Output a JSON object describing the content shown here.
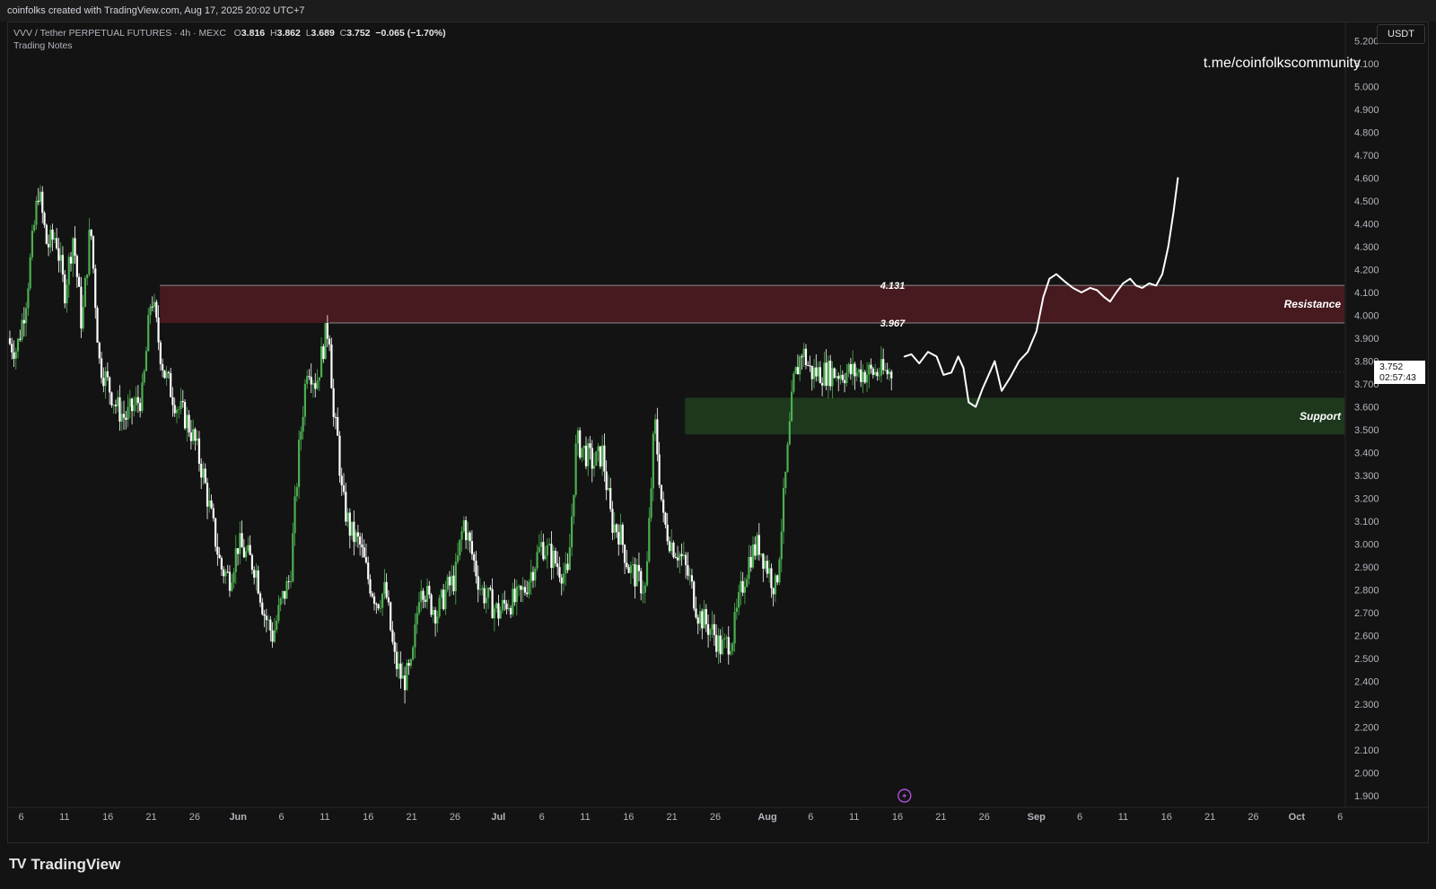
{
  "header": {
    "attribution": "coinfolks created with TradingView.com, Aug 17, 2025 20:02 UTC+7"
  },
  "legend": {
    "symbol": "VVV / Tether PERPETUAL FUTURES · 4h · MEXC",
    "o_label": "O",
    "o_value": "3.816",
    "h_label": "H",
    "h_value": "3.862",
    "l_label": "L",
    "l_value": "3.689",
    "c_label": "C",
    "c_value": "3.752",
    "change": "−0.065 (−1.70%)",
    "indicator": "Trading Notes"
  },
  "watermark": "t.me/coinfolkscommunity",
  "currency": "USDT",
  "last_price": {
    "value": "3.752",
    "countdown": "02:57:43"
  },
  "brand": {
    "logo_mark": "TV",
    "name": "TradingView"
  },
  "colors": {
    "background": "#131313",
    "up": "#4caf50",
    "down": "#ffffff",
    "resistance_zone": "#4a1a20",
    "support_zone": "#1f3a1f"
  },
  "chart_data": {
    "type": "line",
    "title": "VVV / Tether PERPETUAL FUTURES · 4h · MEXC",
    "ylabel": "USDT",
    "y_axis_side": "right",
    "ylim": [
      1.85,
      5.28
    ],
    "y_ticks": [
      "5.200",
      "5.100",
      "5.000",
      "4.900",
      "4.800",
      "4.700",
      "4.600",
      "4.500",
      "4.400",
      "4.300",
      "4.200",
      "4.100",
      "4.000",
      "3.900",
      "3.800",
      "3.700",
      "3.600",
      "3.500",
      "3.400",
      "3.300",
      "3.200",
      "3.100",
      "3.000",
      "2.900",
      "2.800",
      "2.700",
      "2.600",
      "2.500",
      "2.400",
      "2.300",
      "2.200",
      "2.100",
      "2.000",
      "1.900"
    ],
    "x_ticks": [
      "6",
      "11",
      "16",
      "21",
      "26",
      "Jun",
      "6",
      "11",
      "16",
      "21",
      "26",
      "Jul",
      "6",
      "11",
      "16",
      "21",
      "26",
      "Aug",
      "6",
      "11",
      "16",
      "21",
      "26",
      "Sep",
      "6",
      "11",
      "16",
      "21",
      "26",
      "Oct",
      "6"
    ],
    "x_tick_days": [
      -25,
      -20,
      -15,
      -10,
      -5,
      0,
      5,
      10,
      15,
      20,
      25,
      30,
      35,
      40,
      45,
      50,
      55,
      61,
      66,
      71,
      76,
      81,
      86,
      92,
      97,
      102,
      107,
      112,
      117,
      122,
      127
    ],
    "xlim_days": [
      -26.5,
      127.5
    ],
    "price_series": {
      "name": "VVV/USDT 4h",
      "days": [
        -27,
        -25.5,
        -24.5,
        -23,
        -22,
        -21,
        -20,
        -19,
        -18,
        -17,
        -16,
        -15,
        -14,
        -13,
        -12,
        -11,
        -10,
        -9,
        -8.5,
        -8,
        -7,
        -6,
        -5,
        -4,
        -3,
        -2,
        -1,
        0,
        1,
        2,
        3,
        4,
        5,
        6,
        7,
        8,
        9,
        10,
        10.5,
        11,
        11.5,
        12,
        13,
        14,
        15,
        16,
        17,
        18,
        19,
        20,
        21,
        22,
        23,
        24,
        25,
        26,
        27,
        28,
        29,
        30,
        31,
        32,
        33,
        34,
        35,
        36,
        37,
        38,
        39,
        40,
        41,
        42,
        43,
        44,
        45,
        46,
        47,
        48,
        49,
        50,
        51,
        52,
        53,
        54,
        55,
        55.5,
        56,
        57,
        58,
        59,
        60,
        61,
        62,
        63,
        64,
        65,
        66,
        67,
        68,
        69,
        70,
        71,
        72,
        73,
        74,
        75,
        75.5,
        76
      ],
      "close": [
        3.9,
        3.85,
        4.05,
        4.55,
        4.3,
        4.35,
        4.1,
        4.35,
        3.95,
        4.4,
        3.8,
        3.7,
        3.6,
        3.55,
        3.6,
        3.65,
        4.1,
        3.85,
        3.75,
        3.7,
        3.6,
        3.55,
        3.45,
        3.3,
        3.1,
        2.9,
        2.85,
        3.0,
        2.95,
        2.9,
        2.7,
        2.6,
        2.75,
        2.85,
        3.4,
        3.8,
        3.7,
        3.9,
        3.95,
        3.55,
        3.45,
        3.2,
        3.05,
        3.0,
        2.85,
        2.75,
        2.8,
        2.5,
        2.4,
        2.45,
        2.85,
        2.75,
        2.7,
        2.8,
        2.85,
        3.1,
        2.95,
        2.8,
        2.75,
        2.7,
        2.75,
        2.75,
        2.8,
        2.9,
        3.0,
        2.95,
        2.9,
        2.85,
        3.45,
        3.4,
        3.35,
        3.4,
        3.1,
        3.05,
        2.9,
        2.85,
        2.8,
        3.55,
        3.1,
        3.0,
        2.95,
        2.85,
        2.7,
        2.65,
        2.6,
        2.55,
        2.55,
        2.6,
        2.8,
        2.95,
        3.0,
        2.9,
        2.8,
        3.25,
        3.7,
        3.85,
        3.75,
        3.75,
        3.75,
        3.75,
        3.75,
        3.75,
        3.75,
        3.75,
        3.75,
        3.75,
        3.752
      ]
    },
    "projection": {
      "name": "projected path",
      "days": [
        76.8,
        77.6,
        78.5,
        79.5,
        80.5,
        81.3,
        82.2,
        83.0,
        83.6,
        84.2,
        85.0,
        85.8,
        86.5,
        87.2,
        88.0,
        89.0,
        90.0,
        91.0,
        92.0,
        92.8,
        93.5,
        94.3,
        95.2,
        96.2,
        97.2,
        98.2,
        99.0,
        99.8,
        100.5,
        101.2,
        102.0,
        102.8,
        103.5,
        104.2,
        105.0,
        105.8,
        106.5,
        107.2,
        107.8,
        108.3
      ],
      "values": [
        3.82,
        3.83,
        3.79,
        3.84,
        3.82,
        3.74,
        3.75,
        3.82,
        3.77,
        3.62,
        3.6,
        3.68,
        3.74,
        3.8,
        3.67,
        3.73,
        3.8,
        3.84,
        3.93,
        4.08,
        4.16,
        4.18,
        4.15,
        4.12,
        4.1,
        4.12,
        4.11,
        4.08,
        4.06,
        4.1,
        4.14,
        4.16,
        4.13,
        4.12,
        4.14,
        4.13,
        4.18,
        4.3,
        4.45,
        4.6
      ]
    },
    "zones": [
      {
        "label": "Resistance",
        "from": 3.967,
        "to": 4.131,
        "start_day": -9,
        "end_day": 127.5,
        "top_text": "4.131",
        "bottom_text": "3.967"
      },
      {
        "label": "Support",
        "from": 3.48,
        "to": 3.64,
        "start_day": 51.5,
        "end_day": 127.5
      }
    ],
    "grid": false,
    "legend": "top-left"
  }
}
